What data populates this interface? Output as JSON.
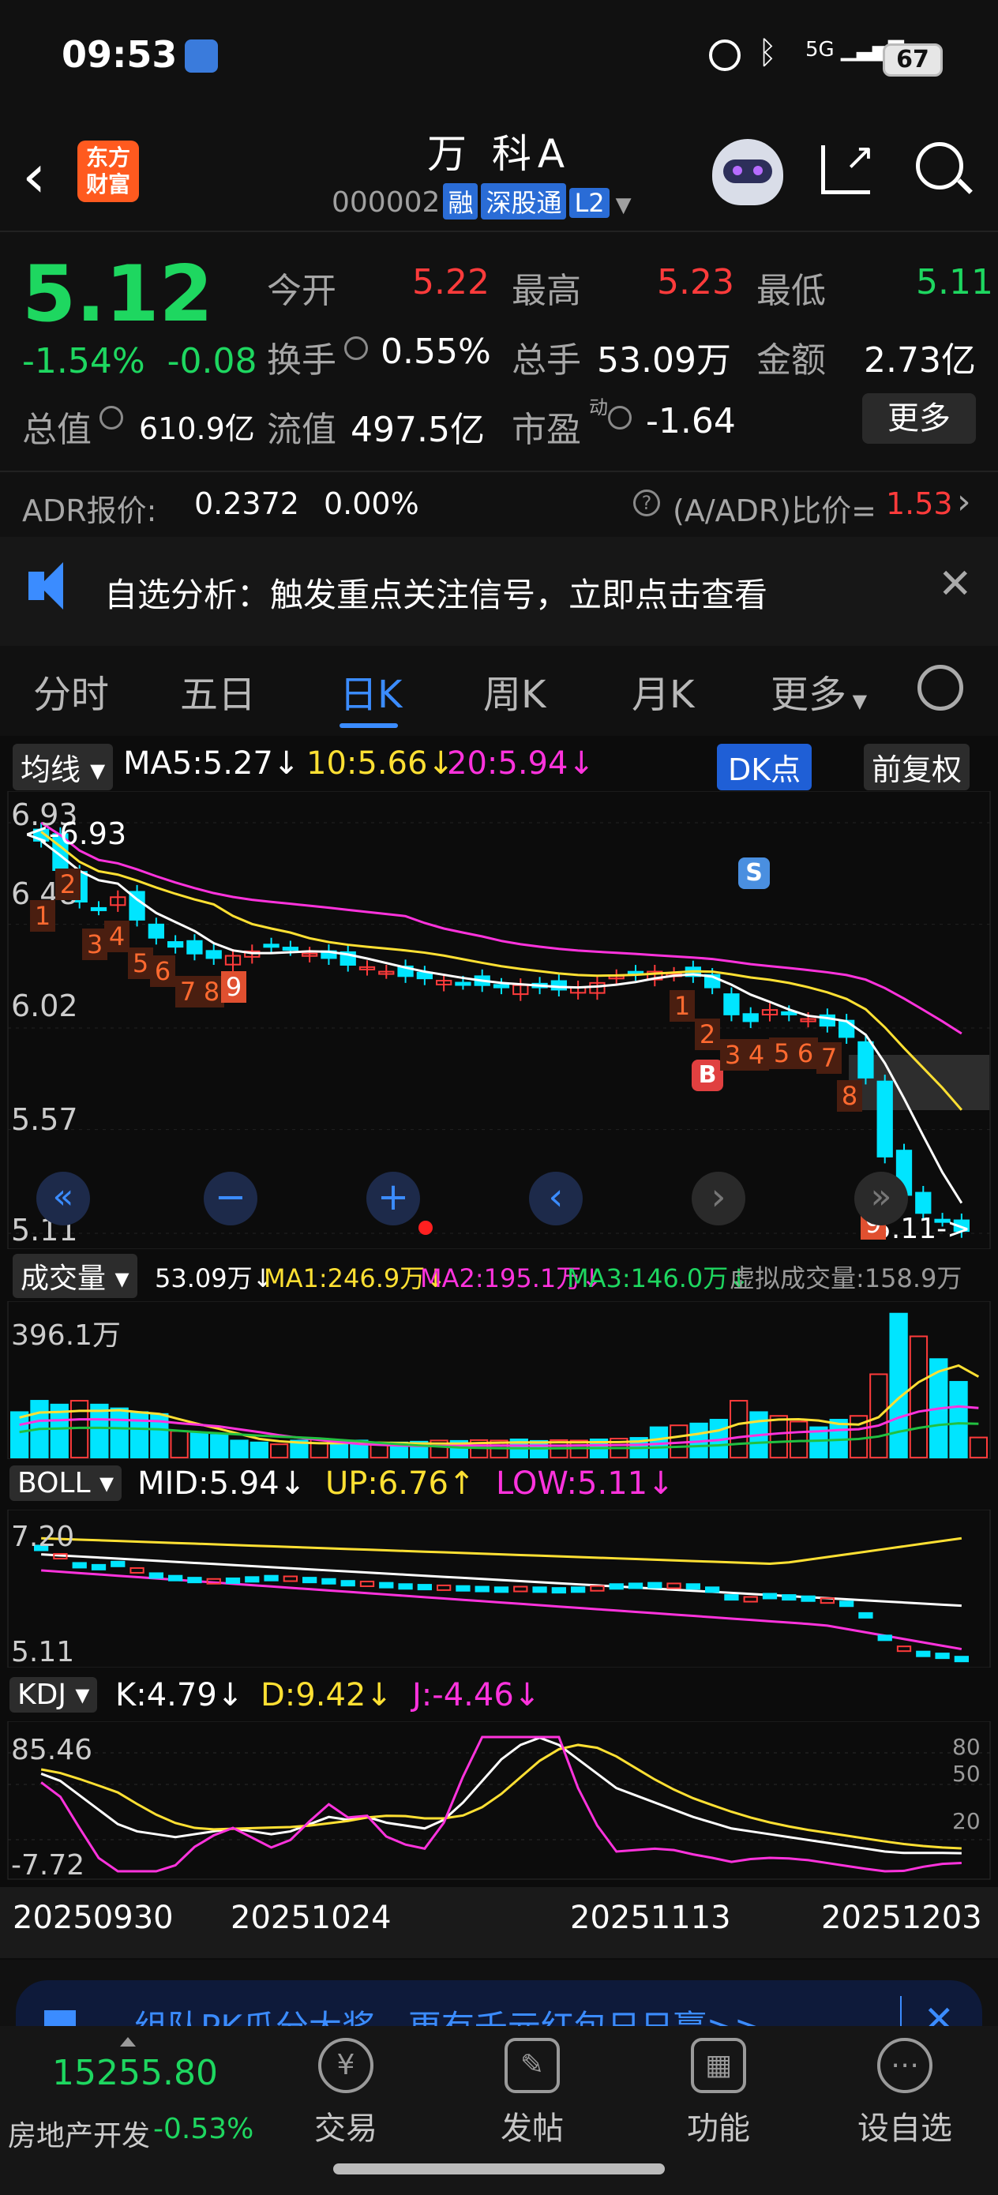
{
  "status_bar": {
    "time": "09:53",
    "network": "5G",
    "battery": "67"
  },
  "header": {
    "logo_text": "东方\n财富",
    "title": "万 科A",
    "code": "000002",
    "tags": [
      "融",
      "深股通",
      "L2"
    ]
  },
  "quote": {
    "price": "5.12",
    "change_pct": "-1.54%",
    "change": "-0.08",
    "open_label": "今开",
    "open": "5.22",
    "high_label": "最高",
    "high": "5.23",
    "low_label": "最低",
    "low": "5.11",
    "turnover_label": "换手",
    "turnover": "0.55%",
    "volume_label": "总手",
    "volume": "53.09万",
    "amount_label": "金额",
    "amount": "2.73亿",
    "mktcap_label": "总值",
    "mktcap": "610.9亿",
    "float_label": "流值",
    "float": "497.5亿",
    "pe_label": "市盈",
    "pe_sup": "动",
    "pe": "-1.64",
    "more_button": "更多",
    "adr_label": "ADR报价:",
    "adr_price": "0.2372",
    "adr_change": "0.00%",
    "adr_ratio_label": "(A/ADR)比价=",
    "adr_ratio": "1.53"
  },
  "notice": {
    "text": "自选分析：触发重点关注信号，立即点击查看"
  },
  "tabs": [
    "分时",
    "五日",
    "日K",
    "周K",
    "月K",
    "更多"
  ],
  "active_tab": "日K",
  "ma_bar": {
    "button": "均线",
    "ma5": "MA5:5.27↓",
    "ma10": "10:5.66↓",
    "ma20": "20:5.94↓",
    "dk_button": "DK点",
    "adj_button": "前复权"
  },
  "kline": {
    "y_labels": [
      "6.93",
      "6.48",
      "6.02",
      "5.57",
      "5.11"
    ],
    "high_marker": "<-6.93",
    "low_marker": "5.11->",
    "signal_s": "S",
    "signal_b": "B",
    "td_seq_1": [
      "1",
      "2",
      "3",
      "4",
      "5",
      "6",
      "7",
      "8",
      "9"
    ],
    "td_seq_2": [
      "1",
      "2",
      "3",
      "4",
      "5",
      "6",
      "7",
      "8",
      "9"
    ]
  },
  "volume_bar": {
    "button": "成交量",
    "vol": "53.09万↓",
    "ma1": "MA1:246.9万↓",
    "ma2": "MA2:195.1万↓",
    "ma3": "MA3:146.0万↓",
    "virtual": "虚拟成交量:158.9万",
    "y_label": "396.1万"
  },
  "boll_bar": {
    "button": "BOLL",
    "mid": "MID:5.94↓",
    "up": "UP:6.76↑",
    "low": "LOW:5.11↓",
    "y_top": "7.20",
    "y_bottom": "5.11"
  },
  "kdj_bar": {
    "button": "KDJ",
    "k": "K:4.79↓",
    "d": "D:9.42↓",
    "j": "J:-4.46↓",
    "y_top": "85.46",
    "y_bottom": "-7.72",
    "right_ticks": [
      "80",
      "50",
      "20"
    ]
  },
  "dates": [
    "20250930",
    "20251024",
    "20251113",
    "20251203"
  ],
  "banner": {
    "text": "组队PK瓜分大奖，更有千元红包日日赢>>"
  },
  "bottom_nav": {
    "index_value": "15255.80",
    "index_name": "房地产开发",
    "index_change": "-0.53%",
    "items": [
      "交易",
      "发帖",
      "功能",
      "设自选"
    ]
  },
  "colors": {
    "up": "#ff3b3b",
    "down": "#00e5ff",
    "accent": "#3b8cff",
    "ma5": "#ffffff",
    "ma10": "#ffe033",
    "ma20": "#ff33dd"
  }
}
